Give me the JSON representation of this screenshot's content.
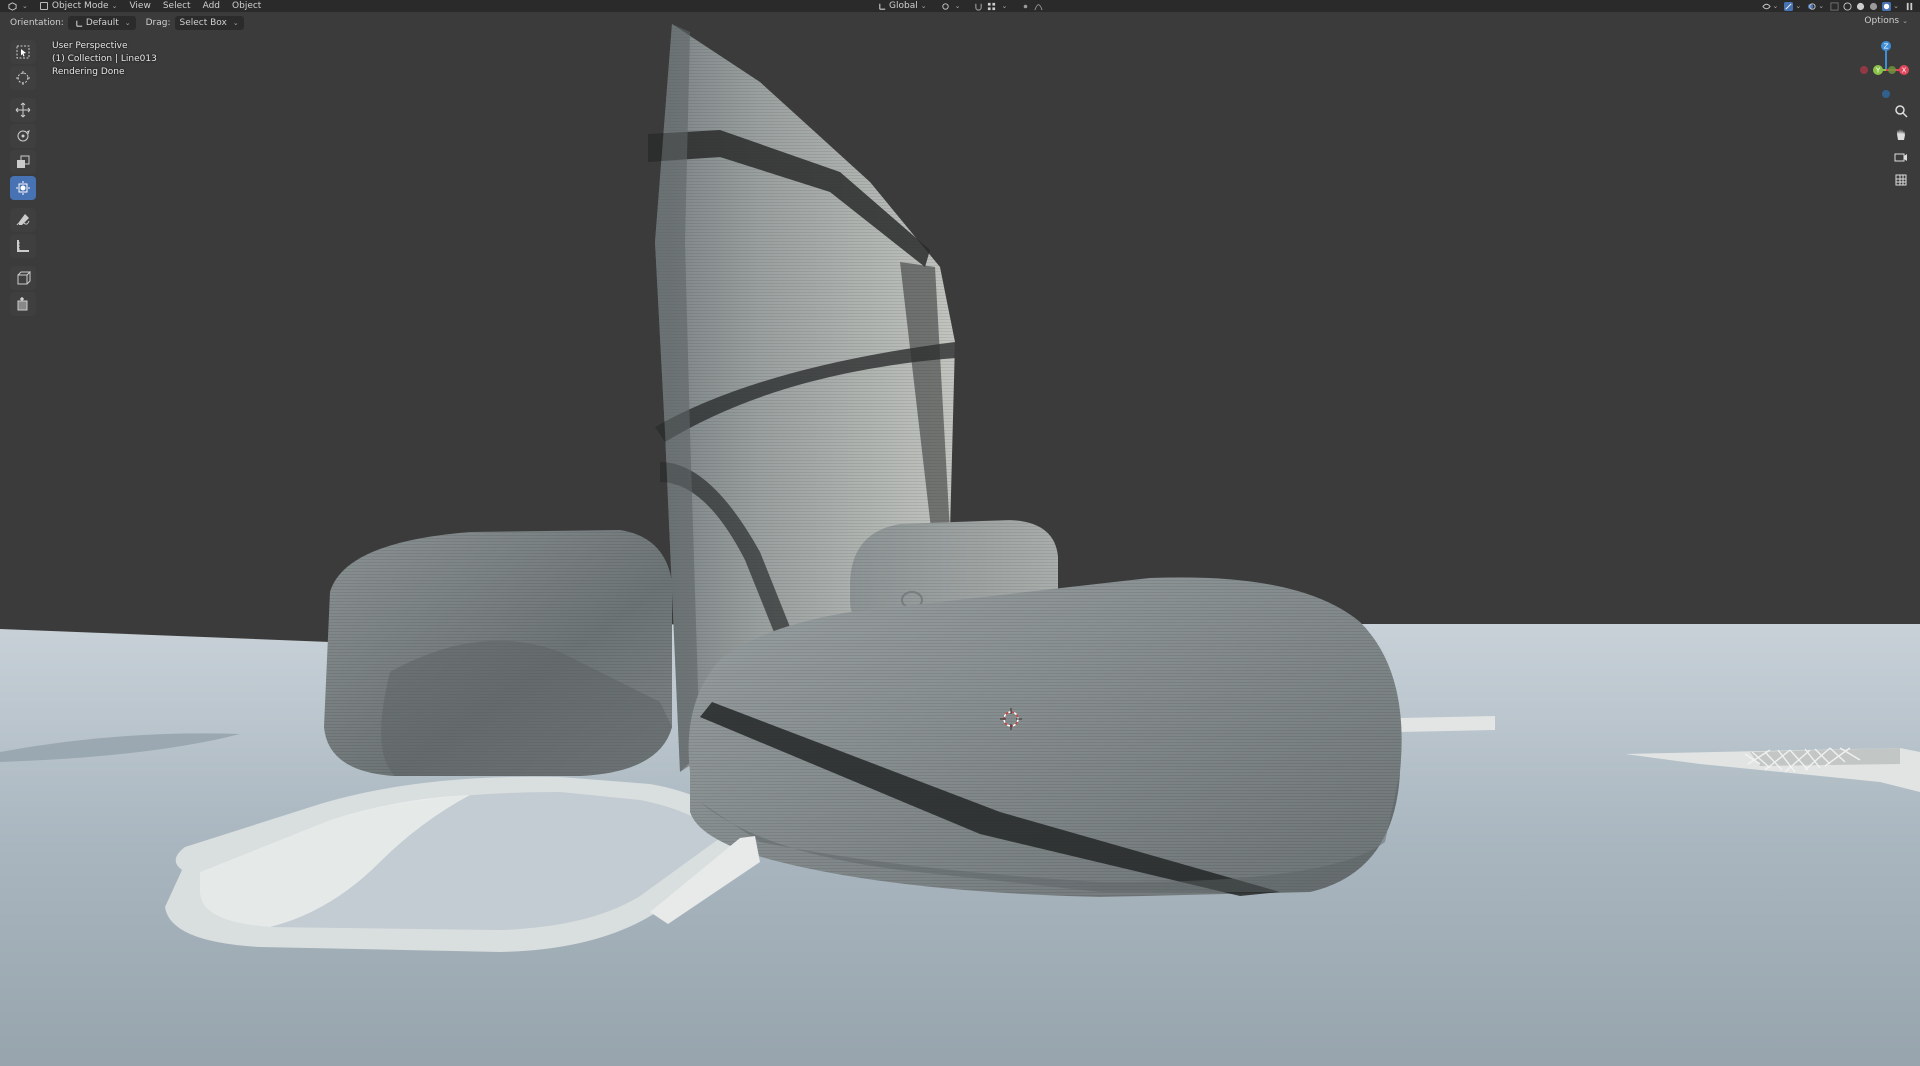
{
  "header": {
    "editor_type_icon": "3d-viewport-icon",
    "mode": "Object Mode",
    "menus": [
      "View",
      "Select",
      "Add",
      "Object"
    ],
    "transform_orientation": "Global"
  },
  "tool_settings": {
    "orientation_label": "Orientation:",
    "orientation_value": "Default",
    "drag_label": "Drag:",
    "drag_value": "Select Box",
    "options_label": "Options"
  },
  "viewport_overlay": {
    "view_name": "User Perspective",
    "collection_object": "(1) Collection | Line013",
    "status": "Rendering Done"
  },
  "toolbar": {
    "tools": [
      {
        "name": "select-box-icon",
        "active": false
      },
      {
        "name": "cursor-icon",
        "active": false
      },
      {
        "name": "move-icon",
        "active": false
      },
      {
        "name": "rotate-icon",
        "active": false
      },
      {
        "name": "scale-icon",
        "active": false
      },
      {
        "name": "transform-icon",
        "active": true
      },
      {
        "name": "annotate-icon",
        "active": false
      },
      {
        "name": "measure-icon",
        "active": false
      },
      {
        "name": "add-cube-icon",
        "active": false
      },
      {
        "name": "add-primitive-icon",
        "active": false
      }
    ]
  },
  "navigation": {
    "gizmo_axes": [
      "Z",
      "Y",
      "X"
    ],
    "buttons": [
      "zoom-icon",
      "hand-pan-icon",
      "camera-icon",
      "grid-ortho-icon"
    ]
  },
  "colors": {
    "accent_active": "#4772b3",
    "background": "#3b3b3b",
    "axis_x": "#e0455a",
    "axis_y": "#8bc34a",
    "axis_z": "#3f8fd8"
  }
}
